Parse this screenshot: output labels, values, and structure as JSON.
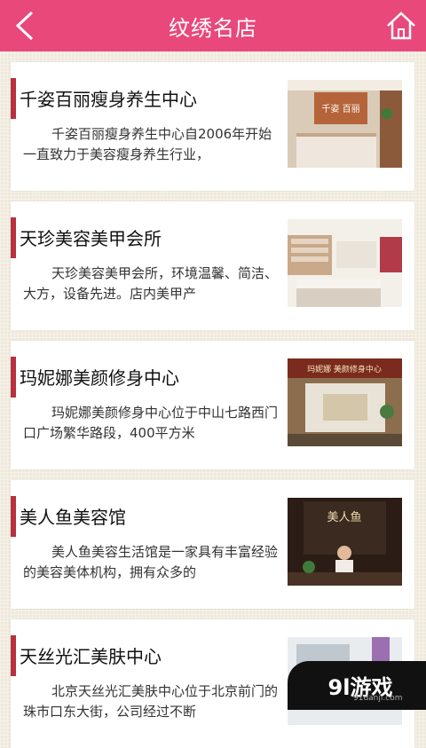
{
  "header": {
    "title": "纹绣名店",
    "back_icon": "back-arrow-icon",
    "home_icon": "home-icon"
  },
  "stores": [
    {
      "name": "千姿百丽瘦身养生中心",
      "description": "千姿百丽瘦身养生中心自2006年开始一直致力于美容瘦身养生行业，",
      "image_sign": "千姿 百丽"
    },
    {
      "name": "天珍美容美甲会所",
      "description": "天珍美容美甲会所，环境温馨、简洁、大方，设备先进。店内美甲产",
      "image_sign": ""
    },
    {
      "name": "玛妮娜美颜修身中心",
      "description": "玛妮娜美颜修身中心位于中山七路西门口广场繁华路段，400平方米",
      "image_sign": "玛妮娜 美颜修身中心"
    },
    {
      "name": "美人鱼美容馆",
      "description": "美人鱼美容生活馆是一家具有丰富经验的美容美体机构，拥有众多的",
      "image_sign": "美人鱼"
    },
    {
      "name": "天丝光汇美肤中心",
      "description": "北京天丝光汇美肤中心位于北京前门的珠市口东大街，公司经过不断",
      "image_sign": ""
    }
  ],
  "watermark": {
    "logo": "9l游戏",
    "url": "91danji.com"
  },
  "colors": {
    "header": "#e8497a",
    "accent": "#b7313f"
  }
}
